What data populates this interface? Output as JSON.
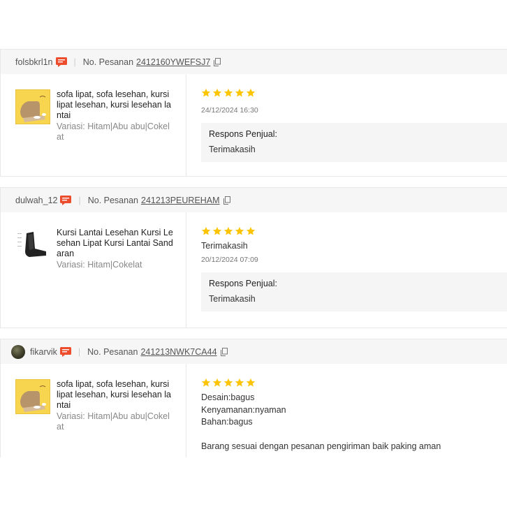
{
  "reviews": [
    {
      "username": "folsbkrl1n",
      "order_label": "No. Pesanan",
      "order_no": "2412160YWEFSJ7",
      "product_name": "sofa lipat, sofa lesehan, kursi lipat lesehan, kursi lesehan la ntai",
      "variation": "Variasi: Hitam|Abu abu|Cokel at",
      "rating": 5,
      "lines": [],
      "date": "24/12/2024 16:30",
      "seller_response_title": "Respons Penjual:",
      "seller_response": "Terimakasih"
    },
    {
      "username": "dulwah_12",
      "order_label": "No. Pesanan",
      "order_no": "241213PEUREHAM",
      "product_name": "Kursi Lantai Lesehan Kursi Le sehan Lipat Kursi Lantai Sand aran",
      "variation": "Variasi: Hitam|Cokelat",
      "rating": 5,
      "lines": [
        "Terimakasih"
      ],
      "date": "20/12/2024 07:09",
      "seller_response_title": "Respons Penjual:",
      "seller_response": "Terimakasih"
    },
    {
      "username": "fikarvik",
      "order_label": "No. Pesanan",
      "order_no": "241213NWK7CA44",
      "product_name": "sofa lipat, sofa lesehan, kursi lipat lesehan, kursi lesehan la ntai",
      "variation": "Variasi: Hitam|Abu abu|Cokel at",
      "rating": 5,
      "lines": [
        "Desain:bagus",
        "Kenyamanan:nyaman",
        "Bahan:bagus",
        "",
        "Barang sesuai dengan pesanan pengiriman baik paking aman"
      ]
    }
  ],
  "colors": {
    "star": "#ffc400",
    "chat_icon": "#ee4d2d",
    "header_bg": "#f6f6f6",
    "response_bg": "#f5f5f5"
  },
  "icons": {
    "chat": "chat-bubble-icon",
    "copy": "copy-icon",
    "star": "star-icon"
  }
}
